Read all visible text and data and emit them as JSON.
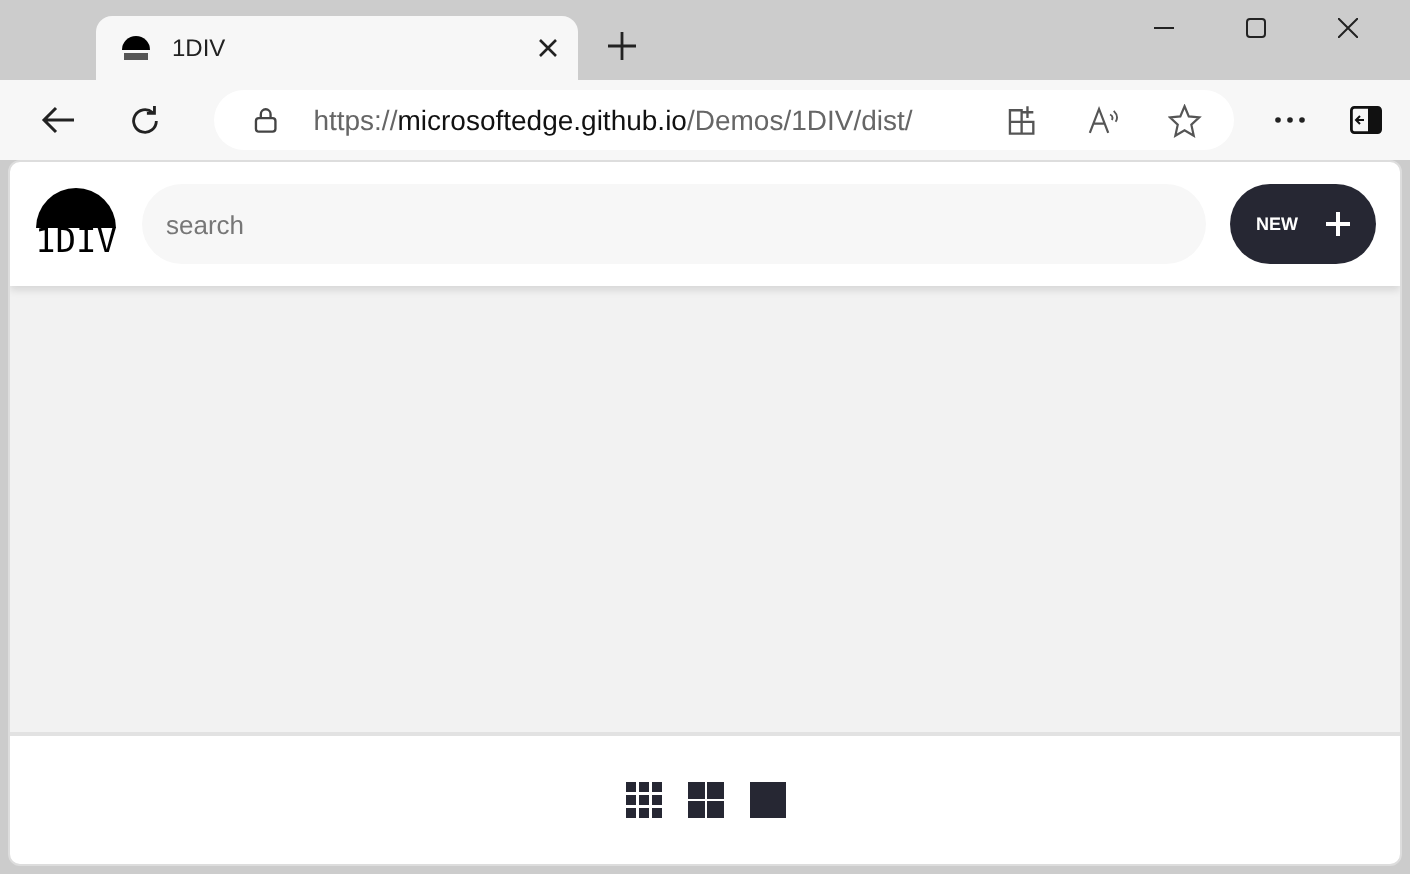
{
  "browser": {
    "tab_title": "1DIV",
    "url_scheme": "https://",
    "url_host": "microsoftedge.github.io",
    "url_path": "/Demos/1DIV/dist/"
  },
  "header": {
    "logo_text": "1DIV",
    "search": {
      "placeholder": "search"
    },
    "new_button": "NEW"
  },
  "view_buttons": [
    {
      "kind": "grid3"
    },
    {
      "kind": "grid2"
    },
    {
      "kind": "single"
    }
  ]
}
